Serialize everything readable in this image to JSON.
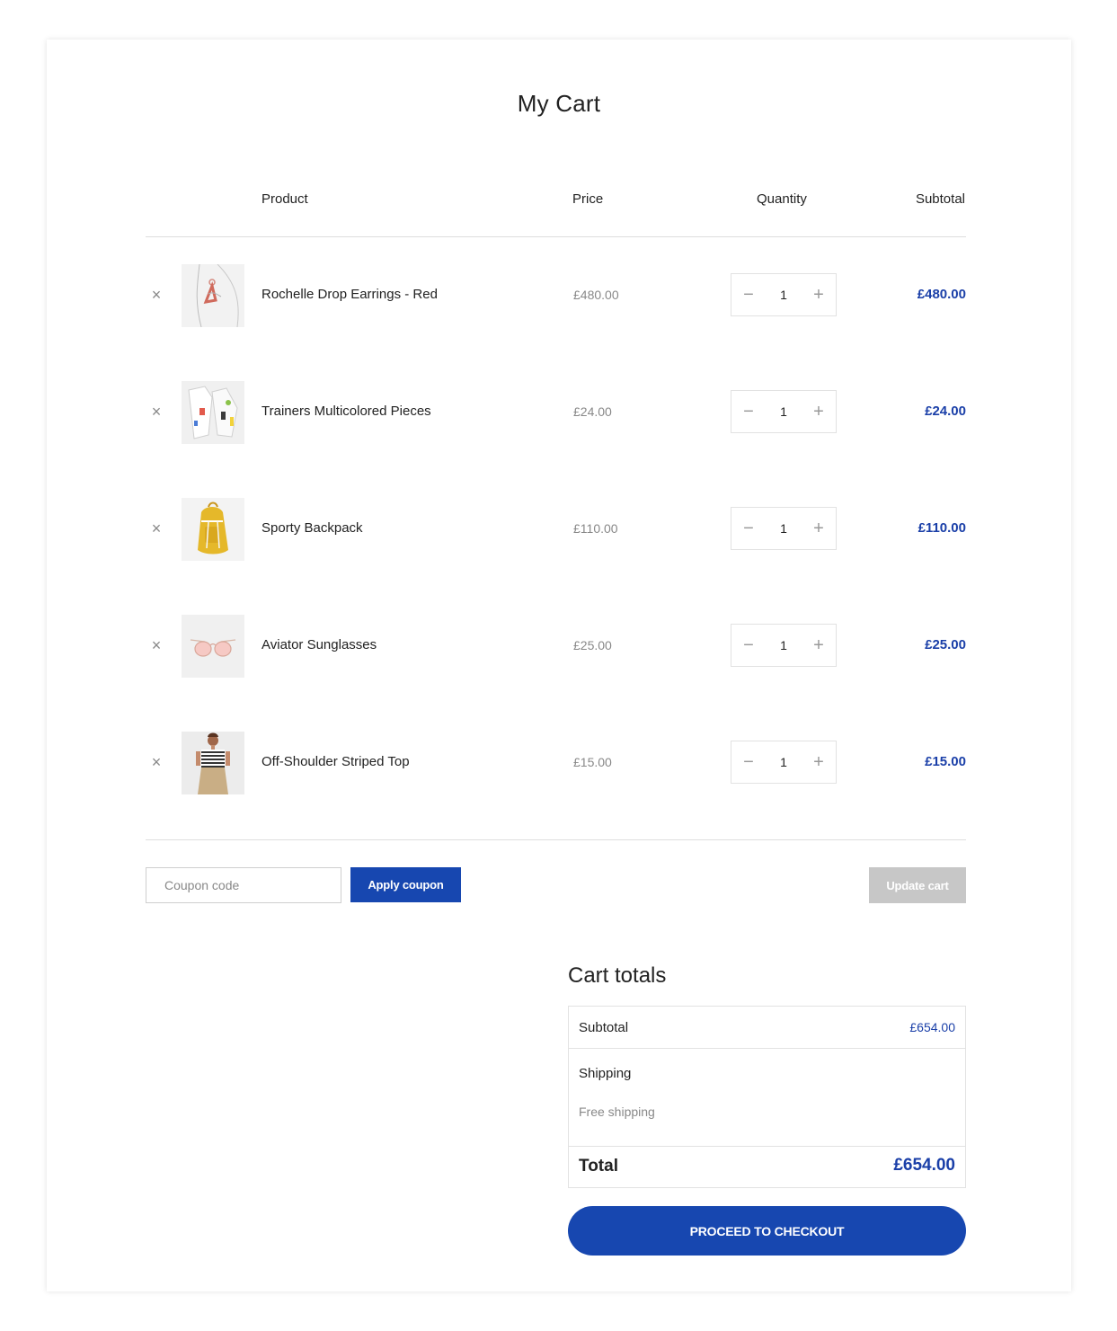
{
  "page_title": "My Cart",
  "table_headers": {
    "product": "Product",
    "price": "Price",
    "quantity": "Quantity",
    "subtotal": "Subtotal"
  },
  "remove_glyph": "×",
  "qty_minus_glyph": "−",
  "qty_plus_glyph": "+",
  "items": [
    {
      "name": "Rochelle Drop Earrings - Red",
      "price": "£480.00",
      "quantity": "1",
      "subtotal": "£480.00",
      "image_icon": "earrings-image"
    },
    {
      "name": "Trainers Multicolored Pieces",
      "price": "£24.00",
      "quantity": "1",
      "subtotal": "£24.00",
      "image_icon": "trainers-image"
    },
    {
      "name": "Sporty Backpack",
      "price": "£110.00",
      "quantity": "1",
      "subtotal": "£110.00",
      "image_icon": "backpack-image"
    },
    {
      "name": "Aviator Sunglasses",
      "price": "£25.00",
      "quantity": "1",
      "subtotal": "£25.00",
      "image_icon": "sunglasses-image"
    },
    {
      "name": "Off-Shoulder Striped Top",
      "price": "£15.00",
      "quantity": "1",
      "subtotal": "£15.00",
      "image_icon": "striped-top-image"
    }
  ],
  "coupon": {
    "placeholder": "Coupon code",
    "value": "",
    "apply_label": "Apply coupon"
  },
  "update_cart_label": "Update cart",
  "cart_totals": {
    "title": "Cart totals",
    "subtotal_label": "Subtotal",
    "subtotal_value": "£654.00",
    "shipping_label": "Shipping",
    "shipping_value": "Free shipping",
    "total_label": "Total",
    "total_value": "£654.00"
  },
  "checkout_label": "PROCEED TO CHECKOUT",
  "colors": {
    "accent": "#1747b0",
    "price_text": "#1a3fa8",
    "muted": "#888888",
    "disabled_button": "#c7c7c7"
  }
}
